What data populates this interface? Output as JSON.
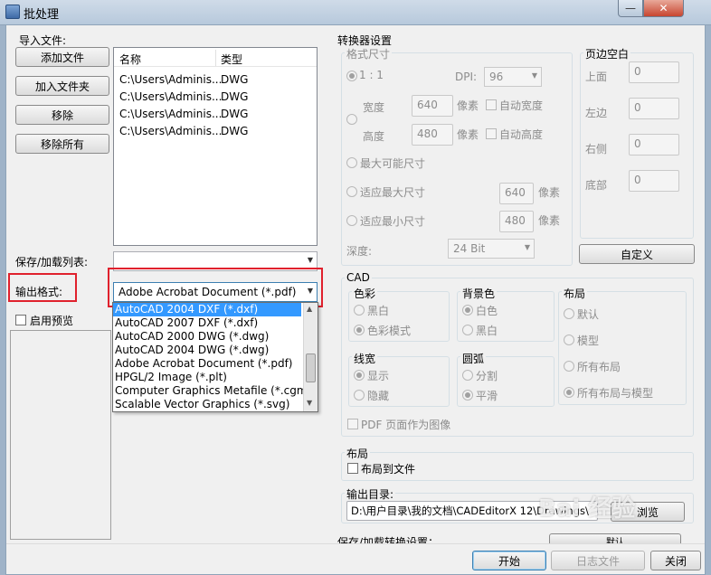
{
  "window": {
    "title": "批处理",
    "minimize_glyph": "—",
    "close_glyph": "✕"
  },
  "left": {
    "import_files_label": "导入文件:",
    "buttons": {
      "add_file": "添加文件",
      "add_folder": "加入文件夹",
      "remove": "移除",
      "remove_all": "移除所有"
    },
    "file_list": {
      "col_name": "名称",
      "col_type": "类型",
      "rows": [
        {
          "name": "C:\\Users\\Adminis...",
          "type": "DWG"
        },
        {
          "name": "C:\\Users\\Adminis...",
          "type": "DWG"
        },
        {
          "name": "C:\\Users\\Adminis...",
          "type": "DWG"
        },
        {
          "name": "C:\\Users\\Adminis...",
          "type": "DWG"
        }
      ]
    },
    "save_load_list_label": "保存/加载列表:",
    "output_format_label": "输出格式:",
    "output_format_value": "Adobe Acrobat Document (*.pdf)",
    "enable_preview_label": "启用预览",
    "format_options": [
      "AutoCAD 2004 DXF (*.dxf)",
      "AutoCAD 2007 DXF (*.dxf)",
      "AutoCAD 2000 DWG (*.dwg)",
      "AutoCAD 2004 DWG (*.dwg)",
      "Adobe Acrobat Document (*.pdf)",
      "HPGL/2 Image (*.plt)",
      "Computer Graphics Metafile (*.cgm)",
      "Scalable Vector Graphics (*.svg)"
    ]
  },
  "right": {
    "converter_settings_label": "转换器设置",
    "format_size": {
      "title": "格式尺寸",
      "ratio": "1 : 1",
      "dpi_label": "DPI:",
      "dpi_value": "96",
      "width_label": "宽度",
      "width_value": "640",
      "pixel_unit": "像素",
      "height_label": "高度",
      "height_value": "480",
      "auto_width": "自动宽度",
      "auto_height": "自动高度",
      "max_possible": "最大可能尺寸",
      "fit_max": "适应最大尺寸",
      "fit_max_value": "640",
      "fit_min": "适应最小尺寸",
      "fit_min_value": "480",
      "depth_label": "深度:",
      "depth_value": "24 Bit"
    },
    "margins": {
      "title": "页边空白",
      "top": "上面",
      "left": "左边",
      "right": "右侧",
      "bottom": "底部",
      "top_value": "0",
      "left_value": "0",
      "right_value": "0",
      "bottom_value": "0",
      "custom_button": "自定义"
    },
    "cad": {
      "title": "CAD",
      "color_title": "色彩",
      "color_bw": "黑白",
      "color_mode": "色彩模式",
      "bg_title": "背景色",
      "bg_white": "白色",
      "bg_black": "黑白",
      "layout_title": "布局",
      "layout_default": "默认",
      "layout_model": "模型",
      "layout_all": "所有布局",
      "layout_all_model": "所有布局与模型",
      "lw_title": "线宽",
      "lw_show": "显示",
      "lw_hide": "隐藏",
      "arc_title": "圆弧",
      "arc_split": "分割",
      "arc_smooth": "平滑",
      "pdf_as_image": "PDF 页面作为图像"
    },
    "layout_group": {
      "title": "布局",
      "layout_to_file": "布局到文件"
    },
    "output_dir": {
      "label": "输出目录:",
      "value": "D:\\用户目录\\我的文档\\CADEditorX 12\\Drawings\\",
      "browse": "浏览"
    },
    "save_load_settings_label": "保存/加载转换设置：",
    "default_button": "默认"
  },
  "bottom": {
    "start": "开始",
    "log_file": "日志文件",
    "close": "关闭"
  },
  "watermark": "Bai 经验"
}
